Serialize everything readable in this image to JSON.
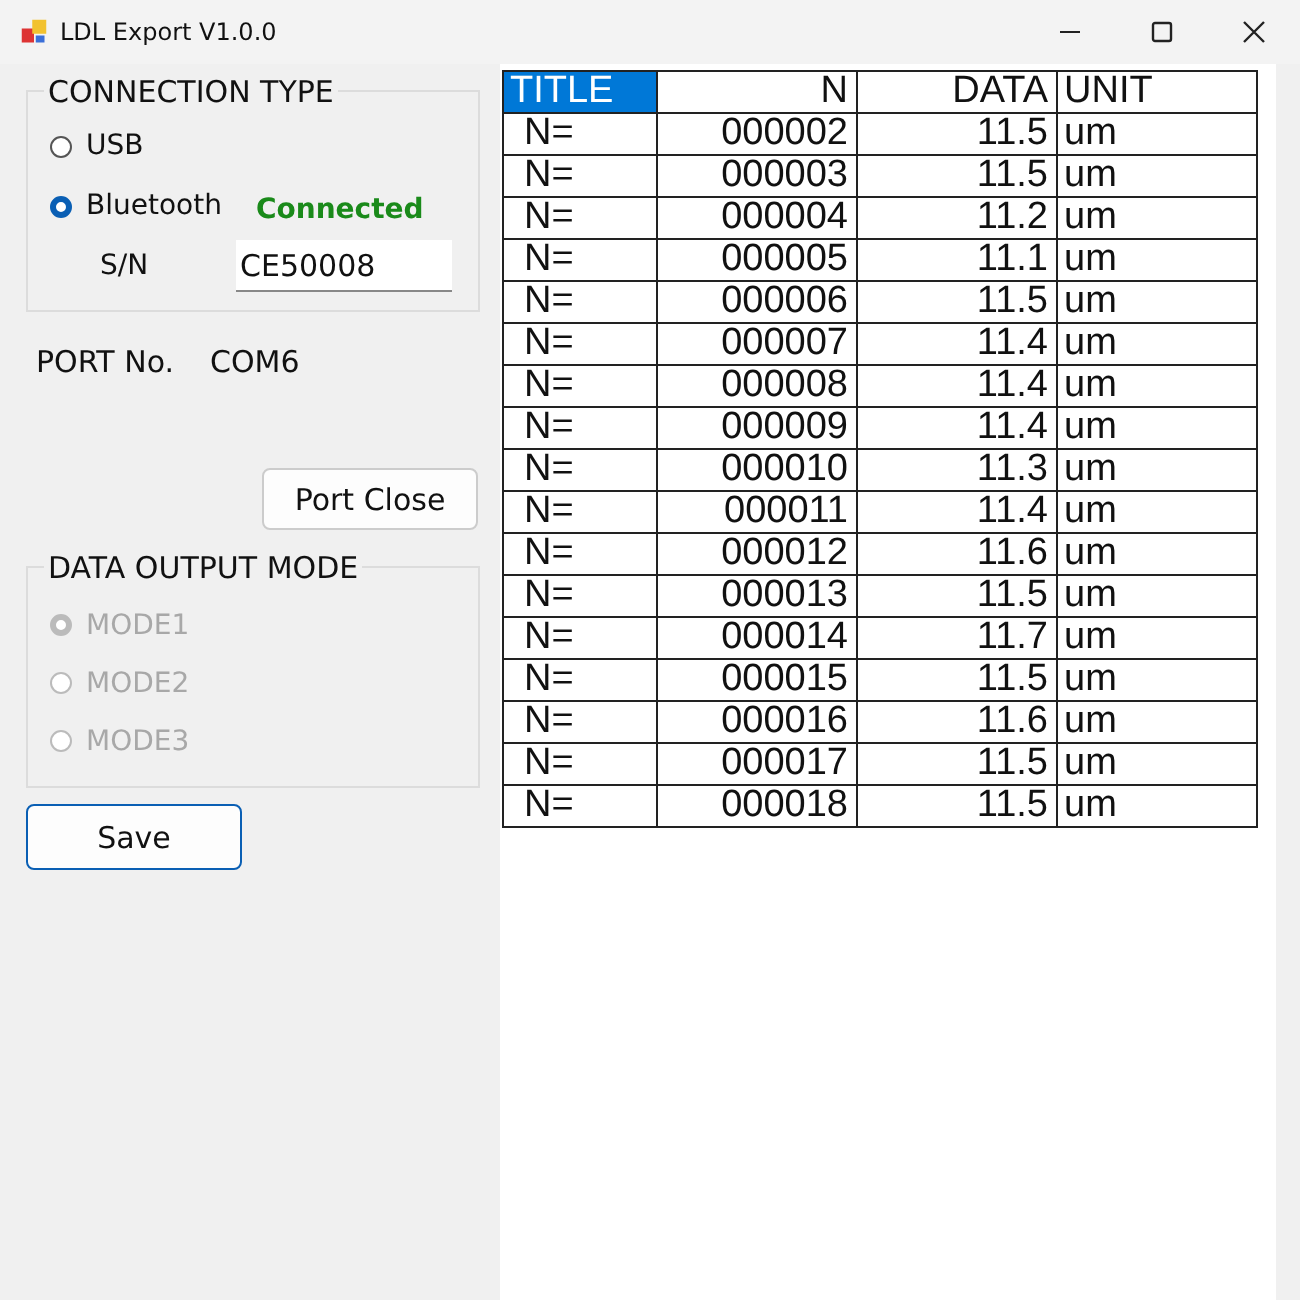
{
  "window": {
    "title": "LDL Export V1.0.0"
  },
  "connection": {
    "title": "CONNECTION TYPE",
    "options": [
      {
        "label": "USB",
        "selected": false
      },
      {
        "label": "Bluetooth",
        "selected": true
      }
    ],
    "status": "Connected",
    "sn_label": "S/N",
    "sn_value": "CE50008"
  },
  "port": {
    "label": "PORT No.",
    "value": "COM6",
    "button": "Port Close"
  },
  "output_mode": {
    "title": "DATA OUTPUT MODE",
    "disabled": true,
    "options": [
      {
        "label": "MODE1",
        "selected": true
      },
      {
        "label": "MODE2",
        "selected": false
      },
      {
        "label": "MODE3",
        "selected": false
      }
    ]
  },
  "save_button": "Save",
  "table": {
    "columns": [
      {
        "label": "TITLE",
        "selected": true
      },
      {
        "label": "N",
        "selected": false
      },
      {
        "label": "DATA",
        "selected": false
      },
      {
        "label": "UNIT",
        "selected": false
      }
    ],
    "rows": [
      [
        "N=",
        "000002",
        "11.5",
        "um"
      ],
      [
        "N=",
        "000003",
        "11.5",
        "um"
      ],
      [
        "N=",
        "000004",
        "11.2",
        "um"
      ],
      [
        "N=",
        "000005",
        "11.1",
        "um"
      ],
      [
        "N=",
        "000006",
        "11.5",
        "um"
      ],
      [
        "N=",
        "000007",
        "11.4",
        "um"
      ],
      [
        "N=",
        "000008",
        "11.4",
        "um"
      ],
      [
        "N=",
        "000009",
        "11.4",
        "um"
      ],
      [
        "N=",
        "000010",
        "11.3",
        "um"
      ],
      [
        "N=",
        "000011",
        "11.4",
        "um"
      ],
      [
        "N=",
        "000012",
        "11.6",
        "um"
      ],
      [
        "N=",
        "000013",
        "11.5",
        "um"
      ],
      [
        "N=",
        "000014",
        "11.7",
        "um"
      ],
      [
        "N=",
        "000015",
        "11.5",
        "um"
      ],
      [
        "N=",
        "000016",
        "11.6",
        "um"
      ],
      [
        "N=",
        "000017",
        "11.5",
        "um"
      ],
      [
        "N=",
        "000018",
        "11.5",
        "um"
      ]
    ]
  }
}
